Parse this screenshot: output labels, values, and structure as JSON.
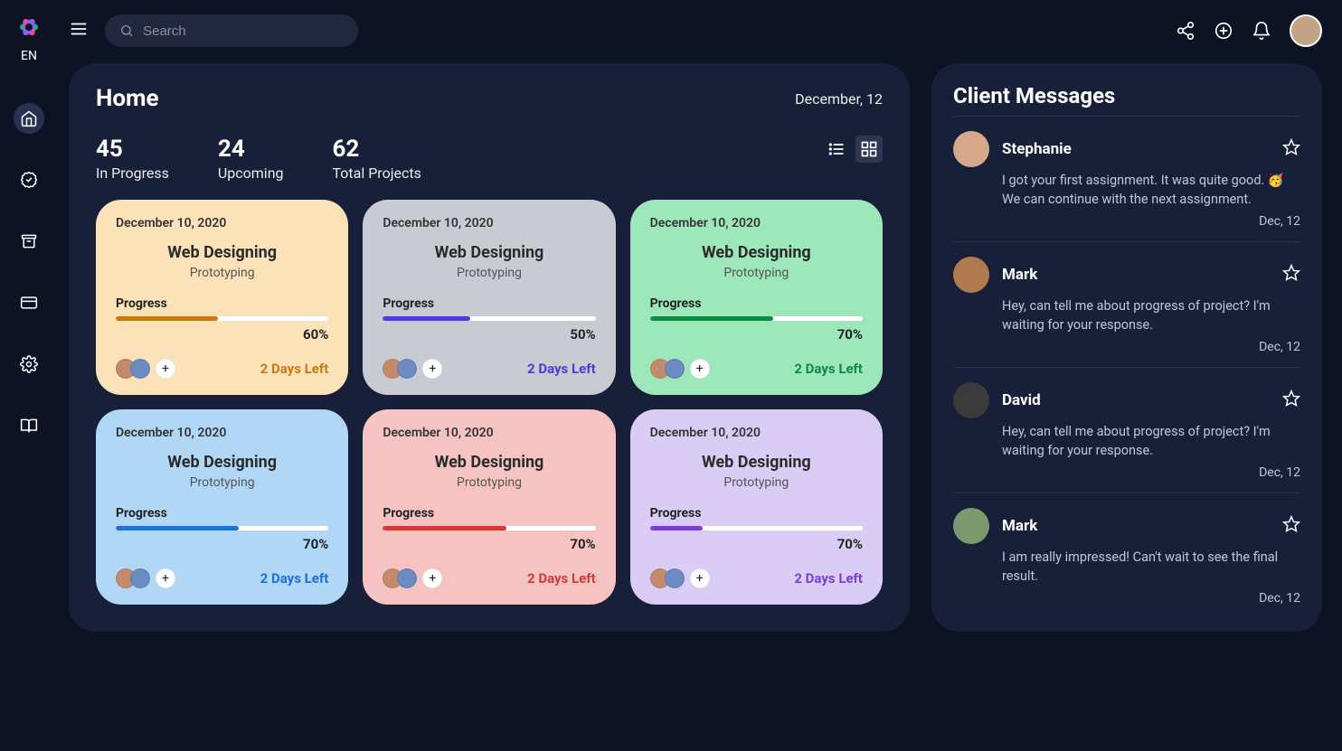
{
  "lang": "EN",
  "search": {
    "placeholder": "Search"
  },
  "page": {
    "title": "Home",
    "date": "December, 12"
  },
  "stats": [
    {
      "value": "45",
      "label": "In Progress"
    },
    {
      "value": "24",
      "label": "Upcoming"
    },
    {
      "value": "62",
      "label": "Total Projects"
    }
  ],
  "cards": [
    {
      "date": "December 10, 2020",
      "title": "Web Designing",
      "sub": "Prototyping",
      "progress_label": "Progress",
      "pct": "60%",
      "width": "48%",
      "days": "2 Days Left",
      "bg": "#fbe2b9",
      "bar": "#c77a12",
      "days_color": "#c77a12"
    },
    {
      "date": "December 10, 2020",
      "title": "Web Designing",
      "sub": "Prototyping",
      "progress_label": "Progress",
      "pct": "50%",
      "width": "41%",
      "days": "2 Days Left",
      "bg": "#c9cbd3",
      "bar": "#4d3dd6",
      "days_color": "#4d3dd6"
    },
    {
      "date": "December 10, 2020",
      "title": "Web Designing",
      "sub": "Prototyping",
      "progress_label": "Progress",
      "pct": "70%",
      "width": "58%",
      "days": "2 Days Left",
      "bg": "#9de8ba",
      "bar": "#0f8a45",
      "days_color": "#0f8a45"
    },
    {
      "date": "December 10, 2020",
      "title": "Web Designing",
      "sub": "Prototyping",
      "progress_label": "Progress",
      "pct": "70%",
      "width": "58%",
      "days": "2 Days Left",
      "bg": "#b0d7f6",
      "bar": "#1f6fd4",
      "days_color": "#1f6fd4"
    },
    {
      "date": "December 10, 2020",
      "title": "Web Designing",
      "sub": "Prototyping",
      "progress_label": "Progress",
      "pct": "70%",
      "width": "58%",
      "days": "2 Days Left",
      "bg": "#f6c3c3",
      "bar": "#d23a3a",
      "days_color": "#d23a3a"
    },
    {
      "date": "December 10, 2020",
      "title": "Web Designing",
      "sub": "Prototyping",
      "progress_label": "Progress",
      "pct": "70%",
      "width": "25%",
      "days": "2 Days Left",
      "bg": "#dacdf5",
      "bar": "#7b3ed4",
      "days_color": "#7b3ed4"
    }
  ],
  "messages_title": "Client Messages",
  "messages": [
    {
      "name": "Stephanie",
      "body": "I got your first assignment. It was quite good. 🥳 We can continue with the next assignment.",
      "date": "Dec, 12",
      "avatar": "#d6a88a"
    },
    {
      "name": "Mark",
      "body": "Hey, can tell me about progress of project? I'm waiting for your response.",
      "date": "Dec, 12",
      "avatar": "#b07a4e"
    },
    {
      "name": "David",
      "body": "Hey, can tell me about progress of project? I'm waiting for your response.",
      "date": "Dec, 12",
      "avatar": "#3a3a3a"
    },
    {
      "name": "Mark",
      "body": "I am really impressed! Can't wait to see the final result.",
      "date": "Dec, 12",
      "avatar": "#7a9a6e"
    }
  ]
}
